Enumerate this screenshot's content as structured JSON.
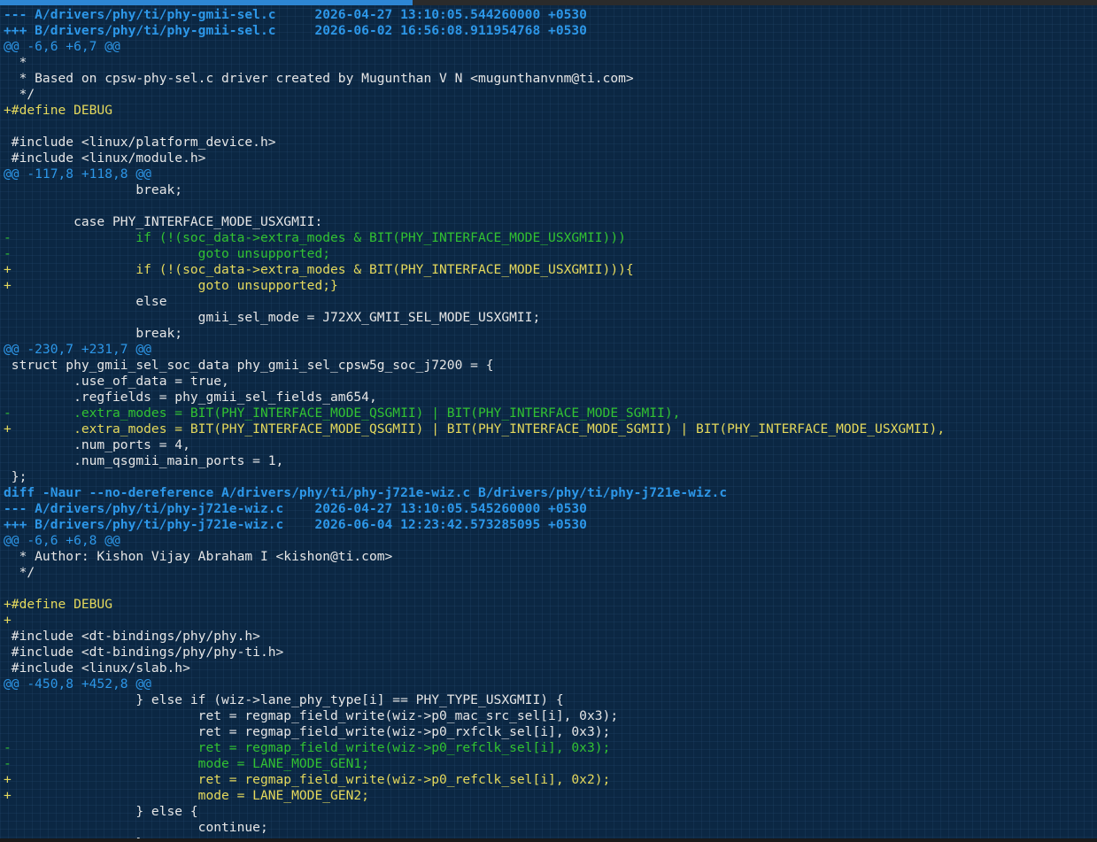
{
  "terminal": {
    "lines": [
      {
        "kind": "fh",
        "text": "--- A/drivers/phy/ti/phy-gmii-sel.c     2026-04-27 13:10:05.544260000 +0530"
      },
      {
        "kind": "fh",
        "text": "+++ B/drivers/phy/ti/phy-gmii-sel.c     2026-06-02 16:56:08.911954768 +0530"
      },
      {
        "kind": "hunk",
        "text": "@@ -6,6 +6,7 @@"
      },
      {
        "kind": "ctx",
        "text": "  *"
      },
      {
        "kind": "ctx",
        "text": "  * Based on cpsw-phy-sel.c driver created by Mugunthan V N <mugunthanvnm@ti.com>"
      },
      {
        "kind": "ctx",
        "text": "  */"
      },
      {
        "kind": "add",
        "text": "+#define DEBUG"
      },
      {
        "kind": "ctx",
        "text": ""
      },
      {
        "kind": "ctx",
        "text": " #include <linux/platform_device.h>"
      },
      {
        "kind": "ctx",
        "text": " #include <linux/module.h>"
      },
      {
        "kind": "hunk",
        "text": "@@ -117,8 +118,8 @@"
      },
      {
        "kind": "ctx",
        "text": "                 break;"
      },
      {
        "kind": "ctx",
        "text": ""
      },
      {
        "kind": "ctx",
        "text": "         case PHY_INTERFACE_MODE_USXGMII:"
      },
      {
        "kind": "del",
        "text": "-                if (!(soc_data->extra_modes & BIT(PHY_INTERFACE_MODE_USXGMII)))"
      },
      {
        "kind": "del",
        "text": "-                        goto unsupported;"
      },
      {
        "kind": "add",
        "text": "+                if (!(soc_data->extra_modes & BIT(PHY_INTERFACE_MODE_USXGMII))){"
      },
      {
        "kind": "add",
        "text": "+                        goto unsupported;}"
      },
      {
        "kind": "ctx",
        "text": "                 else"
      },
      {
        "kind": "ctx",
        "text": "                         gmii_sel_mode = J72XX_GMII_SEL_MODE_USXGMII;"
      },
      {
        "kind": "ctx",
        "text": "                 break;"
      },
      {
        "kind": "hunk",
        "text": "@@ -230,7 +231,7 @@"
      },
      {
        "kind": "ctx",
        "text": " struct phy_gmii_sel_soc_data phy_gmii_sel_cpsw5g_soc_j7200 = {"
      },
      {
        "kind": "ctx",
        "text": "         .use_of_data = true,"
      },
      {
        "kind": "ctx",
        "text": "         .regfields = phy_gmii_sel_fields_am654,"
      },
      {
        "kind": "del",
        "text": "-        .extra_modes = BIT(PHY_INTERFACE_MODE_QSGMII) | BIT(PHY_INTERFACE_MODE_SGMII),"
      },
      {
        "kind": "add",
        "text": "+        .extra_modes = BIT(PHY_INTERFACE_MODE_QSGMII) | BIT(PHY_INTERFACE_MODE_SGMII) | BIT(PHY_INTERFACE_MODE_USXGMII),"
      },
      {
        "kind": "ctx",
        "text": "         .num_ports = 4,"
      },
      {
        "kind": "ctx",
        "text": "         .num_qsgmii_main_ports = 1,"
      },
      {
        "kind": "ctx",
        "text": " };"
      },
      {
        "kind": "diff",
        "text": "diff -Naur --no-dereference A/drivers/phy/ti/phy-j721e-wiz.c B/drivers/phy/ti/phy-j721e-wiz.c"
      },
      {
        "kind": "fh",
        "text": "--- A/drivers/phy/ti/phy-j721e-wiz.c    2026-04-27 13:10:05.545260000 +0530"
      },
      {
        "kind": "fh",
        "text": "+++ B/drivers/phy/ti/phy-j721e-wiz.c    2026-06-04 12:23:42.573285095 +0530"
      },
      {
        "kind": "hunk",
        "text": "@@ -6,6 +6,8 @@"
      },
      {
        "kind": "ctx",
        "text": "  * Author: Kishon Vijay Abraham I <kishon@ti.com>"
      },
      {
        "kind": "ctx",
        "text": "  */"
      },
      {
        "kind": "ctx",
        "text": ""
      },
      {
        "kind": "add",
        "text": "+#define DEBUG"
      },
      {
        "kind": "add",
        "text": "+"
      },
      {
        "kind": "ctx",
        "text": " #include <dt-bindings/phy/phy.h>"
      },
      {
        "kind": "ctx",
        "text": " #include <dt-bindings/phy/phy-ti.h>"
      },
      {
        "kind": "ctx",
        "text": " #include <linux/slab.h>"
      },
      {
        "kind": "hunk",
        "text": "@@ -450,8 +452,8 @@"
      },
      {
        "kind": "ctx",
        "text": "                 } else if (wiz->lane_phy_type[i] == PHY_TYPE_USXGMII) {"
      },
      {
        "kind": "ctx",
        "text": "                         ret = regmap_field_write(wiz->p0_mac_src_sel[i], 0x3);"
      },
      {
        "kind": "ctx",
        "text": "                         ret = regmap_field_write(wiz->p0_rxfclk_sel[i], 0x3);"
      },
      {
        "kind": "del",
        "text": "-                        ret = regmap_field_write(wiz->p0_refclk_sel[i], 0x3);"
      },
      {
        "kind": "del",
        "text": "-                        mode = LANE_MODE_GEN1;"
      },
      {
        "kind": "add",
        "text": "+                        ret = regmap_field_write(wiz->p0_refclk_sel[i], 0x2);"
      },
      {
        "kind": "add",
        "text": "+                        mode = LANE_MODE_GEN2;"
      },
      {
        "kind": "ctx",
        "text": "                 } else {"
      },
      {
        "kind": "ctx",
        "text": "                         continue;"
      },
      {
        "kind": "ctx",
        "text": "                 }"
      }
    ]
  },
  "colors": {
    "background": "#0b2743",
    "file_header": "#2d97e8",
    "hunk_header": "#2d97e8",
    "context": "#e6e6e6",
    "removed": "#32c232",
    "added": "#e5d95c",
    "tab_indicator": "#2d86d4"
  }
}
